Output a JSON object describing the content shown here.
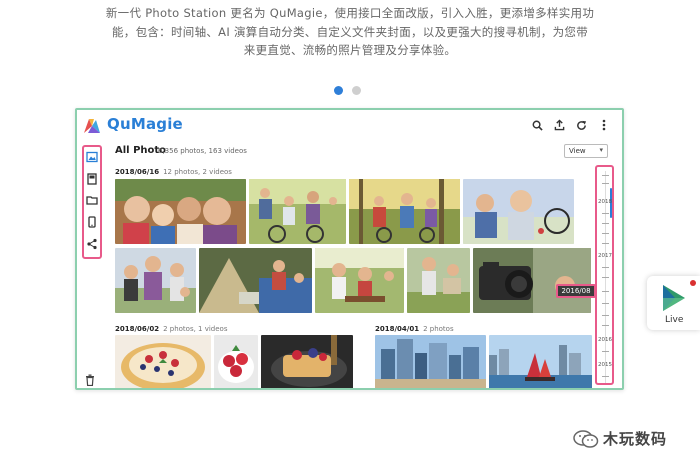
{
  "intro": {
    "line1": "新一代 Photo Station 更名为 QuMagie，使用接口全面改版，引入入胜，更添增多样实用功",
    "line2": "能，包含：时间轴、AI 演算自动分类、自定义文件夹封面，以及更强大的搜寻机制，为您带",
    "line3": "来更直觉、流畅的照片管理及分享体验。"
  },
  "carousel": {
    "total": 2,
    "active": 0
  },
  "app": {
    "brand": "QuMagie",
    "top_icons": [
      "search-icon",
      "upload-icon",
      "refresh-icon",
      "more-vert-icon"
    ],
    "sidebar_icons": [
      "photos-icon",
      "album-icon",
      "folder-icon",
      "phone-icon",
      "share-icon"
    ],
    "page_title": "All Photo",
    "page_meta": "6,356 photos, 163 videos",
    "view_label": "View",
    "sections": [
      {
        "date": "2018/06/16",
        "meta": "12 photos, 2 videos"
      },
      {
        "date": "2018/06/02",
        "meta": "2 photos, 1 videos"
      },
      {
        "date": "2018/04/01",
        "meta": "2 photos"
      }
    ],
    "timeline": {
      "years": [
        "2018",
        "2017",
        "2016",
        "2015"
      ],
      "current": "2016/08"
    }
  },
  "live_badge": {
    "label": "Live"
  },
  "watermark": {
    "text": "木玩数码"
  },
  "colors": {
    "brand": "#2a7fd6",
    "highlight": "#e85a8a",
    "frame": "#8ccfae"
  }
}
